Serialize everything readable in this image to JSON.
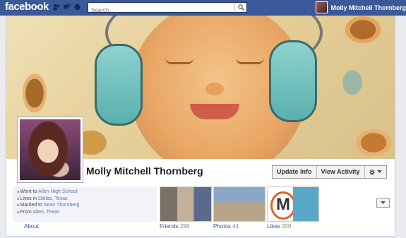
{
  "topbar": {
    "logo": "facebook",
    "search_placeholder": "Search",
    "user_name": "Molly Mitchell Thornberg"
  },
  "profile": {
    "name": "Molly Mitchell Thornberg",
    "actions": {
      "update_info": "Update Info",
      "view_activity": "View Activity"
    }
  },
  "about": {
    "lines": [
      {
        "prefix": "Went to ",
        "link": "Allen High School"
      },
      {
        "prefix": "Lives in ",
        "link": "Dallas, Texas"
      },
      {
        "prefix": "Married to ",
        "link": "Sean Thornberg"
      },
      {
        "prefix": "From ",
        "link": "Allen, Texas"
      }
    ],
    "label": "About"
  },
  "tabs": {
    "friends": {
      "label": "Friends",
      "count": "296"
    },
    "photos": {
      "label": "Photos",
      "count": "44"
    },
    "likes": {
      "label": "Likes",
      "count": "200"
    }
  }
}
